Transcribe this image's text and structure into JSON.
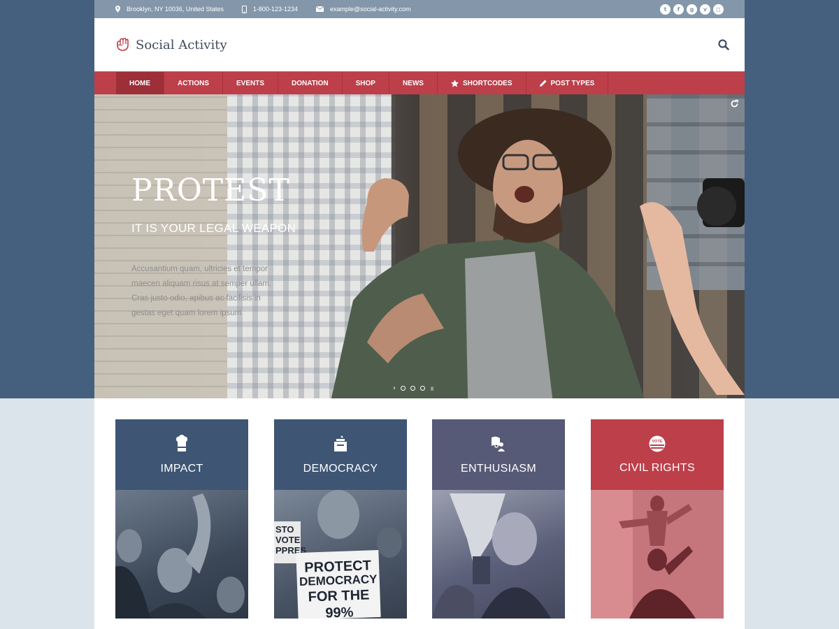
{
  "topbar": {
    "address": "Brooklyn, NY 10036, United States",
    "phone": "1-800-123-1234",
    "email": "example@social-activity.com",
    "social": [
      {
        "name": "twitter",
        "glyph": "t"
      },
      {
        "name": "facebook",
        "glyph": "f"
      },
      {
        "name": "google-plus",
        "glyph": "g"
      },
      {
        "name": "vimeo",
        "glyph": "v"
      },
      {
        "name": "instagram",
        "glyph": "◻"
      }
    ]
  },
  "header": {
    "logo_text": "Social Activity"
  },
  "nav": {
    "items": [
      {
        "label": "HOME",
        "active": true
      },
      {
        "label": "ACTIONS"
      },
      {
        "label": "EVENTS"
      },
      {
        "label": "DONATION"
      },
      {
        "label": "SHOP"
      },
      {
        "label": "NEWS"
      },
      {
        "label": "SHORTCODES",
        "icon": "star-icon"
      },
      {
        "label": "POST TYPES",
        "icon": "pencil-icon"
      }
    ]
  },
  "hero": {
    "title": "PROTEST",
    "subtitle": "IT IS YOUR LEGAL WEAPON",
    "text": "Accusantium quam, ultricies et tempor maecen aliquam risus at semper ullam. Cras justo odio, apibus ac facilisis in gestas eget quam lorem ipsum",
    "arrow": "›",
    "pause": "॥"
  },
  "cards": [
    {
      "title": "IMPACT",
      "icon": "chef-hat-icon"
    },
    {
      "title": "DEMOCRACY",
      "icon": "ballot-box-icon",
      "sign": {
        "l1": "PROTECT",
        "l2": "DEMOCRACY",
        "l3": "FOR THE 99%"
      },
      "sign2": "STO VOTE PPRES"
    },
    {
      "title": "ENTHUSIASM",
      "icon": "flag-people-icon"
    },
    {
      "title": "CIVIL RIGHTS",
      "icon": "vote-badge-icon",
      "badge": "VOTE"
    }
  ],
  "colors": {
    "background": "#44607e",
    "topbar": "#8396aa",
    "nav": "#bc3f4a",
    "nav_active": "#9d2f39",
    "card_blue": "#3e5574",
    "card_purple": "#575a76",
    "card_red": "#bc3f4a"
  }
}
